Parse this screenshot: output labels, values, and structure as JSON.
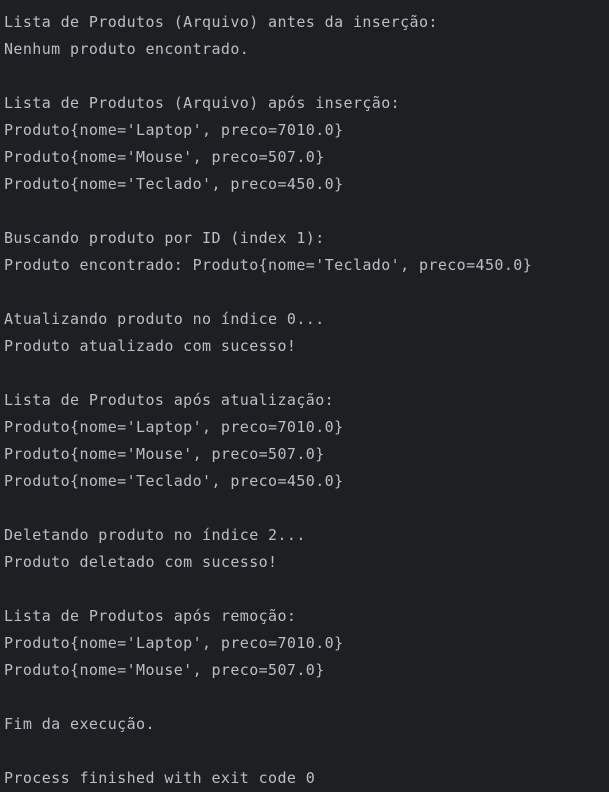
{
  "console": {
    "lines": [
      "Lista de Produtos (Arquivo) antes da inserção:",
      "Nenhum produto encontrado.",
      "",
      "Lista de Produtos (Arquivo) após inserção:",
      "Produto{nome='Laptop', preco=7010.0}",
      "Produto{nome='Mouse', preco=507.0}",
      "Produto{nome='Teclado', preco=450.0}",
      "",
      "Buscando produto por ID (index 1):",
      "Produto encontrado: Produto{nome='Teclado', preco=450.0}",
      "",
      "Atualizando produto no índice 0...",
      "Produto atualizado com sucesso!",
      "",
      "Lista de Produtos após atualização:",
      "Produto{nome='Laptop', preco=7010.0}",
      "Produto{nome='Mouse', preco=507.0}",
      "Produto{nome='Teclado', preco=450.0}",
      "",
      "Deletando produto no índice 2...",
      "Produto deletado com sucesso!",
      "",
      "Lista de Produtos após remoção:",
      "Produto{nome='Laptop', preco=7010.0}",
      "Produto{nome='Mouse', preco=507.0}",
      "",
      "Fim da execução.",
      "",
      "Process finished with exit code 0"
    ]
  },
  "colors": {
    "background": "#1e1f22",
    "text": "#bcbec4"
  }
}
